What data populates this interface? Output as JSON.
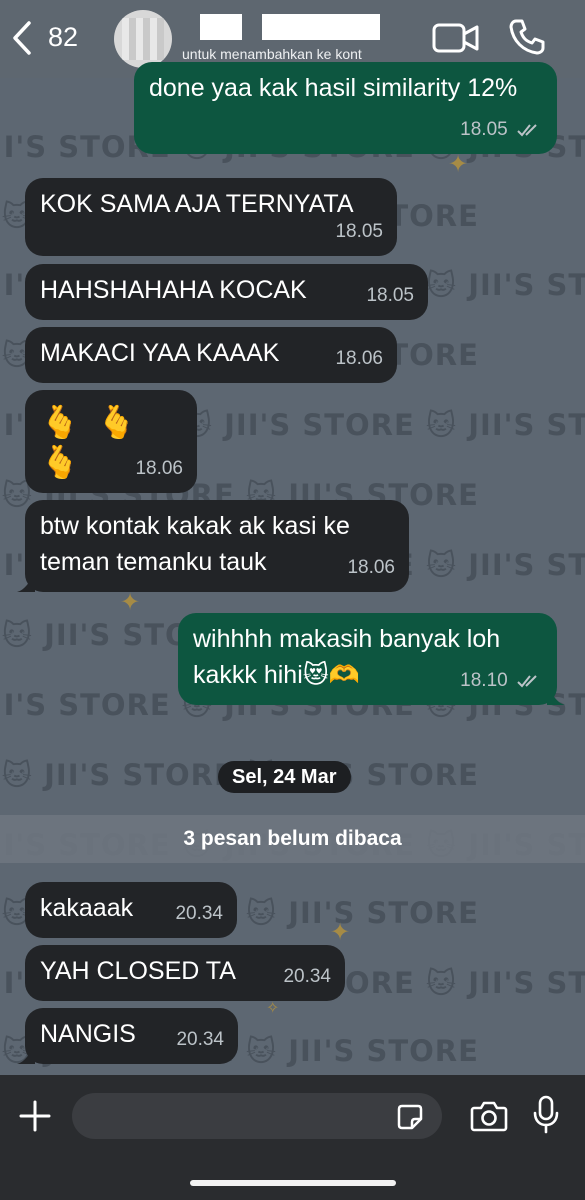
{
  "header": {
    "back_count": "82",
    "contact_subtitle": "untuk menambahkan ke kont"
  },
  "wallpaper": {
    "watermark": "JII'S STORE 🐱 JII'S STORE 🐱 JII'S STORE"
  },
  "messages": [
    {
      "direction": "out",
      "text": "done yaa kak hasil similarity 12%",
      "time": "18.05",
      "status": "read"
    },
    {
      "direction": "in",
      "text": "KOK SAMA AJA TERNYATA",
      "time": "18.05"
    },
    {
      "direction": "in",
      "text": "HAHSHAHAHA KOCAK",
      "time": "18.05"
    },
    {
      "direction": "in",
      "text": "MAKACI YAA KAAAK",
      "time": "18.06"
    },
    {
      "direction": "in",
      "text": "🫰 🫰 🫰",
      "time": "18.06"
    },
    {
      "direction": "in",
      "text": "btw kontak kakak ak kasi ke teman temanku tauk",
      "time": "18.06"
    },
    {
      "direction": "out",
      "text": "wihhhh makasih banyak loh kakkk hihi😻🫶",
      "time": "18.10",
      "status": "read"
    }
  ],
  "date_separator": "Sel, 24 Mar",
  "unread_banner": "3 pesan belum dibaca",
  "unread_messages": [
    {
      "direction": "in",
      "text": "kakaaak",
      "time": "20.34"
    },
    {
      "direction": "in",
      "text": "YAH CLOSED TA",
      "time": "20.34"
    },
    {
      "direction": "in",
      "text": "NANGIS",
      "time": "20.34"
    }
  ],
  "input": {
    "placeholder": ""
  },
  "colors": {
    "outgoing_bubble": "#0d5640",
    "incoming_bubble": "#222427",
    "accent": "#25d366"
  }
}
